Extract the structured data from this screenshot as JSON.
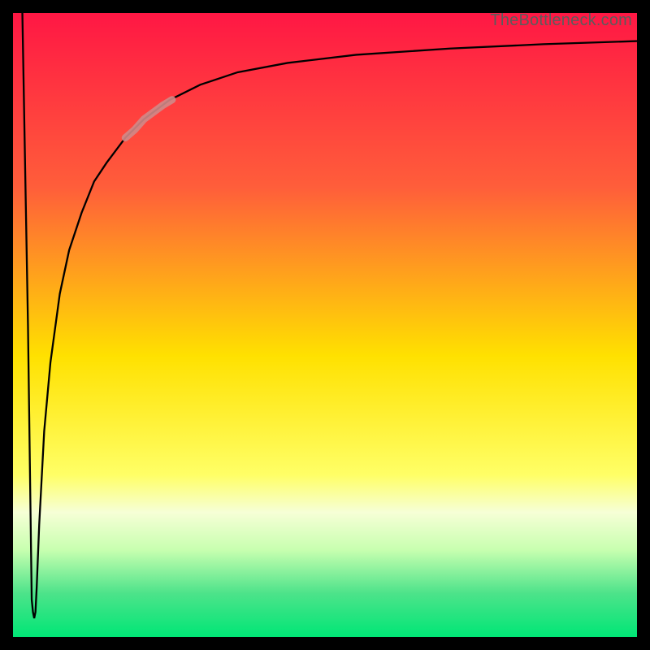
{
  "watermark": "TheBottleneck.com",
  "chart_data": {
    "type": "line",
    "title": "",
    "xlabel": "",
    "ylabel": "",
    "xlim": [
      0,
      100
    ],
    "ylim": [
      0,
      100
    ],
    "gradient_stops": [
      {
        "offset": 0,
        "color": "#ff1744"
      },
      {
        "offset": 28,
        "color": "#ff5e3a"
      },
      {
        "offset": 55,
        "color": "#ffe100"
      },
      {
        "offset": 74,
        "color": "#ffff66"
      },
      {
        "offset": 80,
        "color": "#f6ffd6"
      },
      {
        "offset": 86,
        "color": "#c8ffb0"
      },
      {
        "offset": 93,
        "color": "#4de38a"
      },
      {
        "offset": 100,
        "color": "#00e676"
      }
    ],
    "series": [
      {
        "name": "curve",
        "stroke": "#000000",
        "width": 2.3,
        "x": [
          1.5,
          2.4,
          3.0,
          3.2,
          3.4,
          3.6,
          3.8,
          4.2,
          5.0,
          6.0,
          7.5,
          9.0,
          11,
          13,
          15,
          18,
          21,
          25,
          30,
          36,
          44,
          55,
          70,
          85,
          100
        ],
        "y": [
          100,
          50,
          6,
          4,
          3,
          4,
          8,
          18,
          33,
          44,
          55,
          62,
          68,
          73,
          76,
          80,
          83,
          86,
          88.5,
          90.5,
          92,
          93.3,
          94.3,
          95,
          95.5
        ]
      },
      {
        "name": "highlight",
        "stroke": "#d08a88",
        "width": 9,
        "opacity": 0.9,
        "linecap": "round",
        "x": [
          18,
          19.5,
          21,
          22.5,
          24,
          25.5
        ],
        "y": [
          80,
          81.3,
          83,
          84.1,
          85.2,
          86.1
        ]
      }
    ]
  }
}
